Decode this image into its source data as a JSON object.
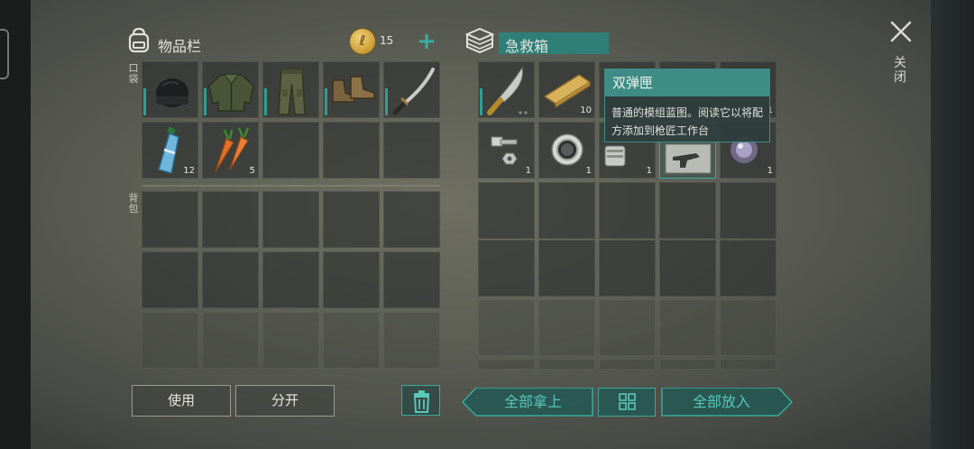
{
  "inventory": {
    "title": "物品栏",
    "coins": "15",
    "add_icon": "plus-icon",
    "pocket_label": "口袋",
    "backpack_label": "背包",
    "pockets": [
      {
        "name": "beanie-hat",
        "qty": "",
        "durability": true
      },
      {
        "name": "jacket",
        "qty": "",
        "durability": true
      },
      {
        "name": "pants",
        "qty": "",
        "durability": true
      },
      {
        "name": "boots",
        "qty": "",
        "durability": true
      },
      {
        "name": "katana",
        "qty": "",
        "durability": true
      },
      {
        "name": "water-bottle",
        "qty": "12",
        "durability": false
      },
      {
        "name": "carrots",
        "qty": "5",
        "durability": false
      }
    ]
  },
  "container": {
    "title": "急救箱",
    "items": [
      {
        "name": "machete",
        "qty": ""
      },
      {
        "name": "wooden-plank",
        "qty": "10"
      },
      {
        "name": "hidden-item",
        "qty": ""
      },
      {
        "name": "hidden-item",
        "qty": ""
      },
      {
        "name": "hidden-item",
        "qty": "1"
      },
      {
        "name": "bolt-and-nut",
        "qty": "1"
      },
      {
        "name": "bearing",
        "qty": "1"
      },
      {
        "name": "engine-part",
        "qty": "1"
      },
      {
        "name": "blueprint",
        "qty": ""
      },
      {
        "name": "lens",
        "qty": "1"
      }
    ]
  },
  "tooltip": {
    "title": "双弹匣",
    "description": "普通的模组蓝图。阅读它以将配方添加到枪匠工作台"
  },
  "actions": {
    "use": "使用",
    "split": "分开",
    "take_all": "全部拿上",
    "put_all": "全部放入",
    "trash_icon": "trash-icon",
    "sort_icon": "grid-icon"
  },
  "window": {
    "close_label": "关闭"
  },
  "colors": {
    "accent": "#3aa99d",
    "tooltip_header": "#3d8c86"
  }
}
